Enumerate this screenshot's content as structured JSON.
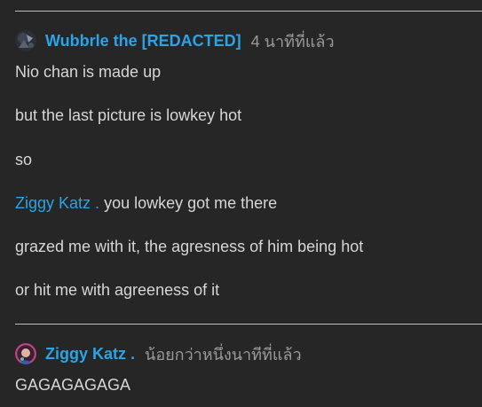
{
  "thread": {
    "comments": [
      {
        "author": "Wubbrle the [REDACTED]",
        "timestamp": "4 นาทีที่แล้ว",
        "lines": [
          "Nio chan is made up",
          "but the last picture is lowkey hot",
          "so",
          "you lowkey got me there",
          "grazed me with it, the agresness of him being hot",
          "or hit me with agreeness of it"
        ],
        "mention": "Ziggy Katz ."
      },
      {
        "author": "Ziggy Katz .",
        "timestamp": "น้อยกว่าหนึ่งนาทีที่แล้ว",
        "lines": [
          "GAGAGAGAGA"
        ]
      }
    ]
  },
  "colors": {
    "background": "#262626",
    "text": "#d6d6d6",
    "link": "#2aa4e6",
    "muted": "#9a9a9a",
    "divider": "#bdbdbd"
  }
}
